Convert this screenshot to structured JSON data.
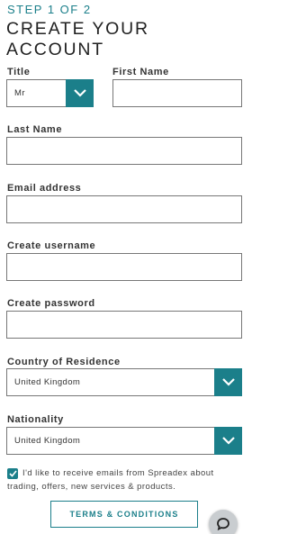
{
  "header": {
    "step": "STEP 1 OF 2",
    "title": "CREATE YOUR ACCOUNT"
  },
  "form": {
    "title_label": "Title",
    "title_value": "Mr",
    "first_name_label": "First Name",
    "first_name_value": "",
    "last_name_label": "Last Name",
    "last_name_value": "",
    "email_label": "Email address",
    "email_value": "",
    "username_label": "Create username",
    "username_value": "",
    "password_label": "Create password",
    "password_value": "",
    "country_label": "Country of Residence",
    "country_value": "United Kingdom",
    "nationality_label": "Nationality",
    "nationality_value": "United Kingdom",
    "consent_text": "I'd like to receive emails from Spreadex about trading, offers, new services & products.",
    "consent_checked": true,
    "terms_button": "TERMS & CONDITIONS"
  },
  "icons": {
    "select_chevron": "chevron-down-icon",
    "checkbox": "check-icon",
    "chat": "chat-bubble-icon"
  },
  "colors": {
    "accent": "#1b7f8a",
    "border": "#777777",
    "chat_bg": "#c9cdd0"
  }
}
